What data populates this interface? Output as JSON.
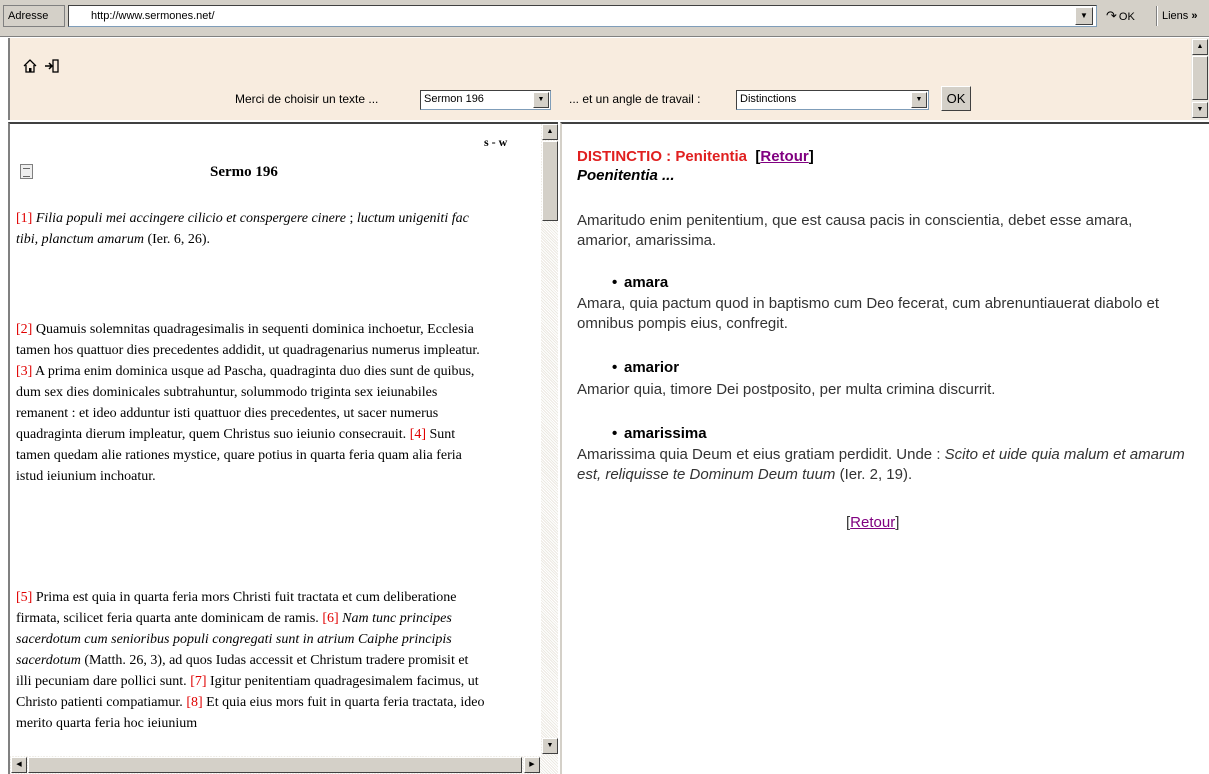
{
  "address_bar": {
    "label": "Adresse",
    "url": "http://www.sermones.net/",
    "go_label": "OK",
    "links_label": "Liens",
    "links_chevron": "»"
  },
  "top_frame": {
    "nav_icons": [
      "home-icon",
      "exit-icon"
    ],
    "choose_text_label": "Merci de choisir un texte ...",
    "text_select_value": "Sermon 196",
    "angle_label": "... et un angle de travail :",
    "angle_select_value": "Distinctions",
    "ok_button": "OK"
  },
  "left_frame": {
    "sw_label": "s - w",
    "title": "Sermo 196",
    "paragraphs": [
      "[1] Filia populi mei accingere cilicio et conspergere cinere ; luctum unigeniti fac tibi, planctum amarum (Ier. 6, 26).",
      "[2] Quamuis solemnitas quadragesimalis in sequenti dominica inchoetur, Ecclesia tamen hos quattuor dies precedentes addidit, ut quadragenarius numerus impleatur. [3] A prima enim dominica usque ad Pascha, quadraginta duo dies sunt de quibus, dum sex dies dominicales subtrahuntur, solummodo triginta sex ieiunabiles remanent : et ideo adduntur isti quattuor dies precedentes, ut sacer numerus quadraginta dierum impleatur, quem Christus suo ieiunio consecrauit. [4] Sunt tamen quedam alie rationes mystice, quare potius in quarta feria quam alia feria istud ieiunium inchoatur.",
      "[5] Prima est quia in quarta feria mors Christi fuit tractata et cum deliberatione firmata, scilicet feria quarta ante dominicam de ramis. [6] Nam tunc principes sacerdotum cum senioribus populi congregati sunt in atrium Caiphe principis sacerdotum (Matth. 26, 3), ad quos Iudas accessit et Christum tradere promisit et illi pecuniam dare pollici sunt. [7] Igitur penitentiam quadragesimalem facimus, ut Christo patienti compatiamur. [8] Et quia eius mors fuit in quarta feria tractata, ideo merito quarta feria hoc ieiunium"
    ]
  },
  "right_frame": {
    "heading": "DISTINCTIO : Penitentia",
    "retour_label": "Retour",
    "subheading": "Poenitentia ...",
    "intro": "Amaritudo enim penitentium, que est causa pacis in conscientia, debet esse amara, amarior, amarissima.",
    "items": [
      {
        "term": "amara",
        "text": "Amara, quia pactum quod in baptismo cum Deo fecerat, cum abrenuntiauerat diabolo et omnibus pompis eius, confregit."
      },
      {
        "term": "amarior",
        "text": "Amarior quia, timore Dei postposito, per multa crimina discurrit."
      },
      {
        "term": "amarissima",
        "text_plain": "Amarissima quia Deum et eius gratiam perdidit. Unde :",
        "text_italic": "Scito et uide quia malum et amarum est, reliquisse te Dominum Deum tuum",
        "text_ref": "(Ier. 2, 19)."
      }
    ],
    "footer_retour": "Retour"
  },
  "colors": {
    "top_frame_bg": "#f8ecdf",
    "verse_number": "#e00000",
    "heading_red": "#e02020",
    "link_visited": "#800080"
  }
}
